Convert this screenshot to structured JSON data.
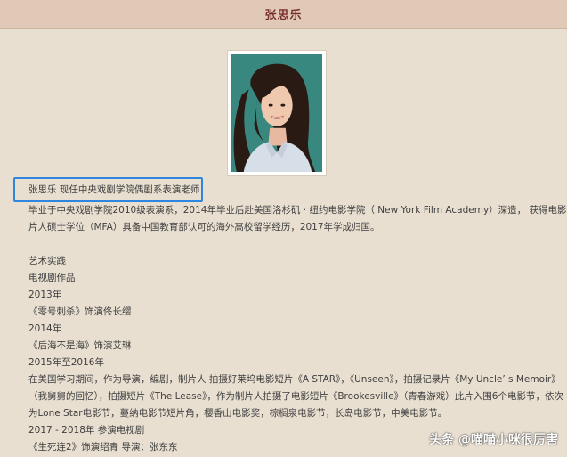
{
  "header": {
    "title": "张思乐"
  },
  "profile": {
    "photo_alt": "portrait photo",
    "highlight_line": "张思乐  现任中央戏剧学院偶剧系表演老师",
    "bio_line_1": "毕业于中央戏剧学院2010级表演系，2014年毕业后赴美国洛杉矶 · 纽约电影学院（ New York Film Academy）深造， 获得电影制",
    "bio_line_2": "片人硕士学位（MFA）具备中国教育部认可的海外高校留学经历，2017年学成归国。"
  },
  "sections": {
    "art_practice": "艺术实践",
    "tv_works": "电视剧作品",
    "year_2013": "2013年",
    "work_2013": "《零号刺杀》饰演佟长缨",
    "year_2014": "2014年",
    "work_2014": "《后海不是海》饰演艾琳",
    "year_2015_2016": "2015年至2016年",
    "us_line_1": "在美国学习期间，作为导演，编剧，制片人 拍摄好莱坞电影短片《A STAR》，《Unseen》，拍摄记录片《My Uncle’ s Memoir》",
    "us_line_2": "（我舅舅的回忆），拍摄短片《The Lease》，作为制片人拍摄了电影短片《Brookesville》（青春游戏）此片入围6个电影节，依次",
    "us_line_3": "为Lone Star电影节，蔓纳电影节短片角，樱香山电影奖，棕榈泉电影节，长岛电影节，中美电影节。",
    "year_2017_2018": "2017 - 2018年 参演电视剧",
    "work_2017": "《生死连2》饰演绍青 导演：张东东"
  },
  "watermark": {
    "text": "头条 @喵喵小咪很厉害"
  },
  "colors": {
    "page_background": "#e8dfd0",
    "header_background": "#e0c9b7",
    "header_text": "#7a2e2b",
    "highlight_border": "#2e86de"
  }
}
